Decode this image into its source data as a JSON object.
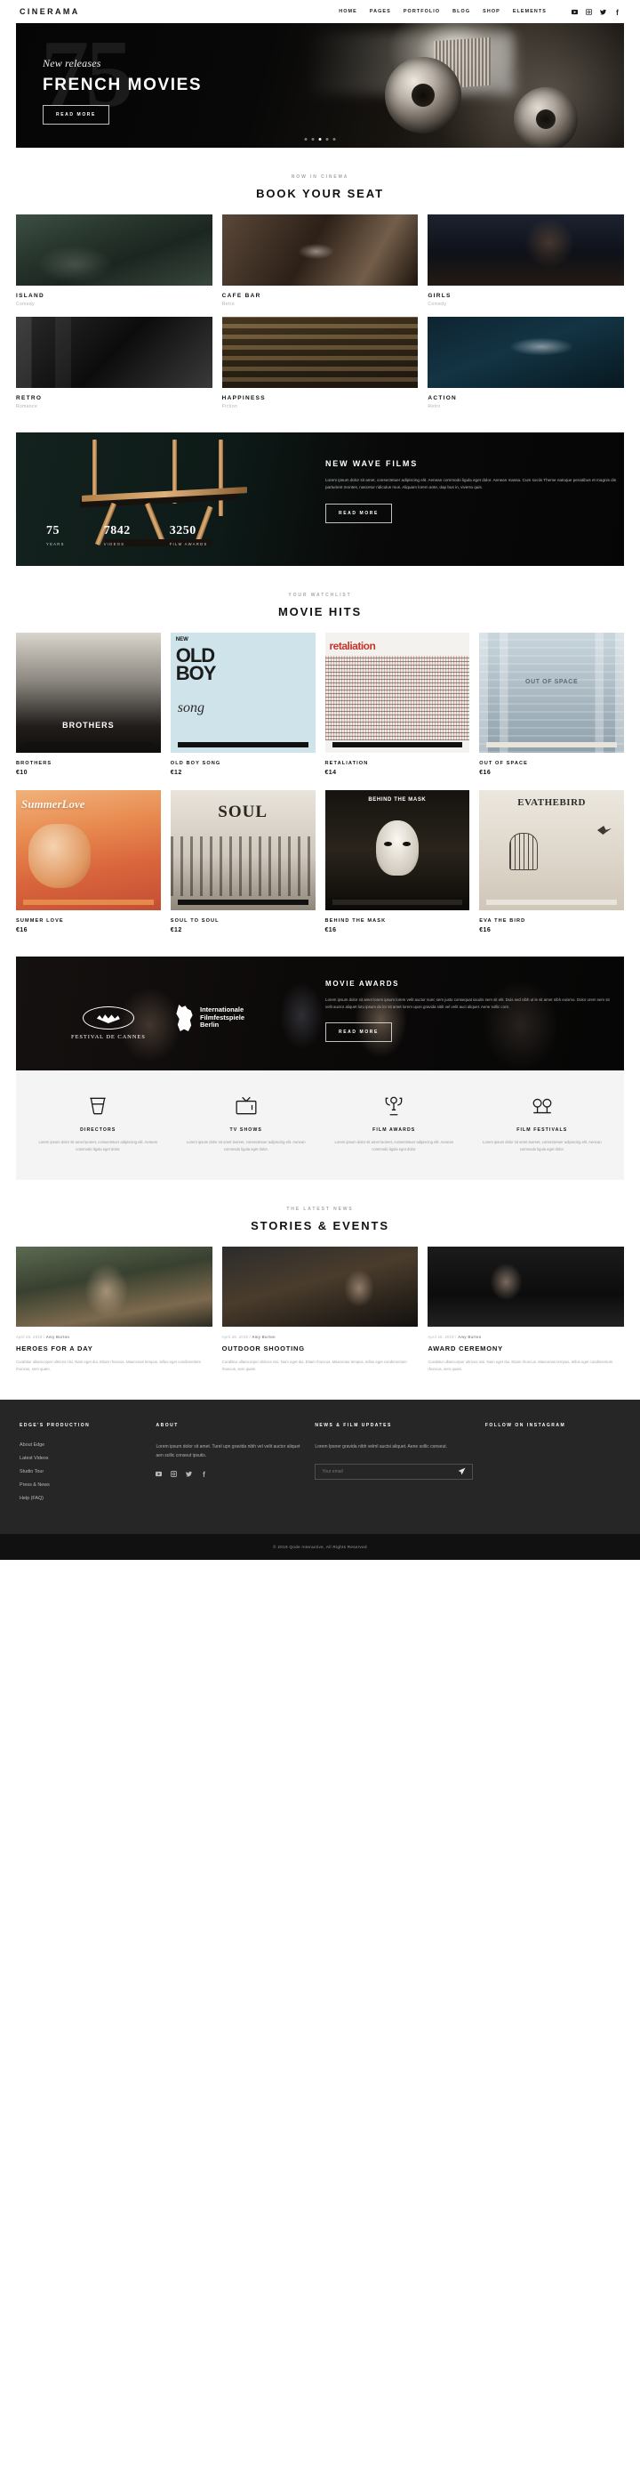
{
  "header": {
    "logo": "CINERAMA",
    "nav": [
      "HOME",
      "PAGES",
      "PORTFOLIO",
      "BLOG",
      "SHOP",
      "ELEMENTS"
    ],
    "socials": [
      "youtube-icon",
      "instagram-icon",
      "twitter-icon",
      "facebook-icon"
    ]
  },
  "hero": {
    "bignum": "75",
    "eyebrow": "New releases",
    "title": "FRENCH MOVIES",
    "cta": "READ MORE",
    "slides": 5,
    "active_slide": 2
  },
  "book": {
    "eyebrow": "NOW IN CINEMA",
    "title": "BOOK YOUR SEAT",
    "items": [
      {
        "name": "ISLAND",
        "genre": "Comedy"
      },
      {
        "name": "CAFE BAR",
        "genre": "Retro"
      },
      {
        "name": "GIRLS",
        "genre": "Comedy"
      },
      {
        "name": "RETRO",
        "genre": "Romance"
      },
      {
        "name": "HAPPINESS",
        "genre": "Fiction"
      },
      {
        "name": "ACTION",
        "genre": "Retro"
      }
    ]
  },
  "banner": {
    "title": "NEW WAVE FILMS",
    "copy": "Lorem ipsum dolor sit amet, consectetuer adipiscing elit. Aenean commodo ligula eget dolor. Aenean massa. Cum sociis Theme natoque penatibus et magnis dis parturient montes, nascetur ridiculus mus. Aliquam lorem ante, dap bus in, viverra quis.",
    "cta": "READ MORE",
    "stats": [
      {
        "number": "75",
        "label": "YEARS"
      },
      {
        "number": "7842",
        "label": "VIDEOS"
      },
      {
        "number": "3250",
        "label": "FILM AWARDS"
      }
    ]
  },
  "hits": {
    "eyebrow": "YOUR WATCHLIST",
    "title": "MOVIE HITS",
    "row1": [
      {
        "name": "BROTHERS",
        "price": "€10",
        "art": "BROTHERS"
      },
      {
        "name": "OLD BOY SONG",
        "price": "€12",
        "art": "OLD BOY song",
        "tag": "NEW"
      },
      {
        "name": "RETALIATION",
        "price": "€14",
        "art": "retaliation"
      },
      {
        "name": "OUT OF SPACE",
        "price": "€16",
        "art": "OUT OF SPACE"
      }
    ],
    "row2": [
      {
        "name": "SUMMER LOVE",
        "price": "€16",
        "art": "SummerLove"
      },
      {
        "name": "SOUL TO SOUL",
        "price": "€12",
        "art": "SOUL"
      },
      {
        "name": "BEHIND THE MASK",
        "price": "€16",
        "art": "BEHIND THE MASK"
      },
      {
        "name": "EVA THE BIRD",
        "price": "€16",
        "art": "EVATHEBIRD"
      }
    ]
  },
  "awards": {
    "festival_cannes": "FESTIVAL DE CANNES",
    "berlin_line1": "Internationale",
    "berlin_line2": "Filmfestspiele",
    "berlin_line3": "Berlin",
    "title": "MOVIE AWARDS",
    "copy": "Lorem ipsum dolor sit amet lorem ipsum lorem velit auctor nunc sem justo consequat iaculis sem sit elit. Duis sed nibh ut le sit amet nibh euismo. Dolor orem sem sit velit auctor aliquet loru ipsum do lor sit amet lorem upon gravida sitib vel velit auci aliquet. Aene sollic cont.",
    "cta": "READ MORE"
  },
  "features": [
    {
      "icon": "director-chair-icon",
      "title": "DIRECTORS",
      "copy": "Lorem ipsum dolor sit amet laoreet, consectetuer adipiscing elit. Aenean commodo ligula eget dolor."
    },
    {
      "icon": "tv-icon",
      "title": "TV SHOWS",
      "copy": "Lorem ipsum dolor sit amet laoreet, consectetuer adipiscing elit. Aenean commodo ligula eget dolor."
    },
    {
      "icon": "trophy-icon",
      "title": "FILM AWARDS",
      "copy": "Lorem ipsum dolor sit amet laoreet, consectetuer adipiscing elit. Aenean commodo ligula eget dolor."
    },
    {
      "icon": "film-festival-icon",
      "title": "FILM FESTIVALS",
      "copy": "Lorem ipsum dolor sit amet laoreet, consectetuer adipiscing elit. Aenean commodo ligula eget dolor."
    }
  ],
  "news": {
    "eyebrow": "THE LATEST NEWS",
    "title": "STORIES & EVENTS",
    "items": [
      {
        "date": "April 26, 2018",
        "by": "Amy Burton",
        "title": "HEROES FOR A DAY",
        "copy": "Curabitur ullamcorper ultrices nisi. Nam eget dui. Etiam rhoncus. Maecenas tempus, tellus eget condimentum rhoncus, sem quam."
      },
      {
        "date": "April 26, 2018",
        "by": "Amy Burton",
        "title": "OUTDOOR SHOOTING",
        "copy": "Curabitur ullamcorper ultrices nisi. Nam eget dui. Etiam rhoncus. Maecenas tempus, tellus eget condimentum rhoncus, sem quam."
      },
      {
        "date": "April 26, 2018",
        "by": "Amy Burton",
        "title": "AWARD CEREMONY",
        "copy": "Curabitur ullamcorper ultrices nisi. Nam eget dui. Etiam rhoncus. Maecenas tempus, tellus eget condimentum rhoncus, sem quam."
      }
    ]
  },
  "footer": {
    "col1_title": "EDGE'S PRODUCTION",
    "col1_links": [
      "About Edge",
      "Latest Videos",
      "Studio Tour",
      "Press & News",
      "Help (FAQ)"
    ],
    "col2_title": "ABOUT",
    "col2_copy": "Lorem ipsum dolor sit amet. Turel upn gravida nibh vel velit auctor aliquet aen sollic conseut ipsutis.",
    "col3_title": "NEWS & FILM UPDATES",
    "col3_copy": "Lorem Ipsner gravida nibh velml auctsi aliquet. Aene sollic conseut.",
    "email_placeholder": "Your email",
    "col4_title": "FOLLOW ON INSTAGRAM",
    "copyright": "© 2018 Qode Interactive, All Rights Reserved"
  }
}
